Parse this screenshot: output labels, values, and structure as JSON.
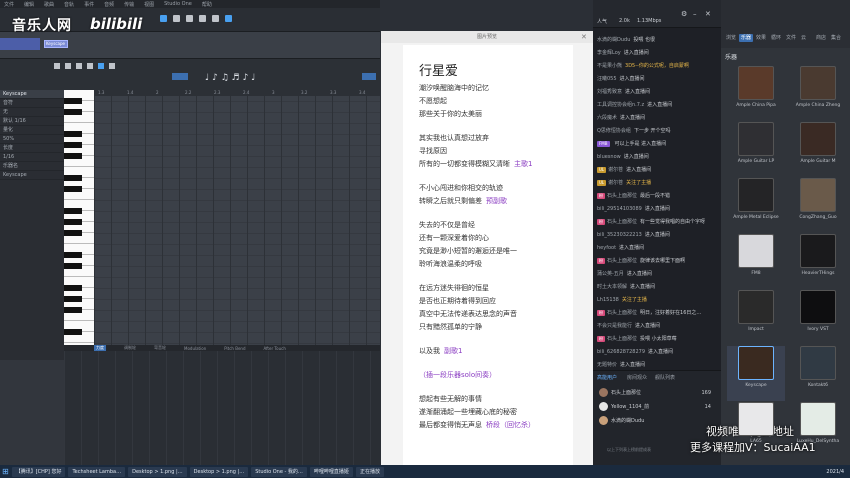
{
  "daw": {
    "menu": [
      "文件",
      "编辑",
      "歌曲",
      "音轨",
      "事件",
      "音频",
      "传输",
      "视图",
      "Studio One",
      "帮助"
    ],
    "track_name": "Keyscape",
    "editor": {
      "instrument": "Keyscape",
      "tabs": [
        "力度",
        "调制轮",
        "弯音轮",
        "Modulation",
        "Pitch Bend",
        "After Touch"
      ],
      "left_panel_rows": [
        "音符",
        "无",
        "默认 1/16",
        "量化",
        "50%",
        "长度",
        "1/16",
        "乐器名",
        "Keyscape"
      ],
      "ruler": [
        "1.3",
        "1.4",
        "2",
        "2.2",
        "2.3",
        "2.4",
        "3",
        "3.2",
        "3.3",
        "3.4"
      ]
    }
  },
  "watermark": {
    "site": "音乐人网",
    "bili": "bilibili"
  },
  "lyrics": {
    "window_title": "图片预览",
    "title": "行星爱",
    "verses": [
      {
        "lines": [
          "潮汐唤醒脑海中的记忆",
          "不愿想起",
          "那些关于你的太美丽"
        ]
      },
      {
        "lines": [
          "其实我也认真想过放弃",
          "寻找原因",
          "所有的一切都变得模糊又清晰"
        ],
        "tag": "主歌1"
      },
      {
        "lines": [
          "不小心闯进和你相交的轨迹",
          "转瞬之后就只剩偏差"
        ],
        "tag": "预副歌"
      },
      {
        "lines": [
          "失去的不仅是曾经",
          "还有一颗深爱着你的心",
          "究竟是渺小短暂的邂逅还是唯一",
          "聆听海浪温柔的呼吸"
        ]
      },
      {
        "lines": [
          "在远方迷失徘徊的恒星",
          "是否也正期待着得到回应",
          "真空中无法传递表达思念的声音",
          "只有黯然孤单的宁静"
        ]
      },
      {
        "lines": [
          "以及我"
        ],
        "tag": "副歌1"
      },
      {
        "lines": [
          "（插一段乐器solo间奏）"
        ],
        "purple": true
      },
      {
        "lines": [
          "想起有些无解的事情",
          "遂渐翻涌起一些埋藏心底的秘密",
          "最后都变得悄无声息"
        ],
        "tag": "桥段（回忆杀）"
      }
    ]
  },
  "chat": {
    "header": {
      "popularity": "人气",
      "value": "2.0k",
      "bitrate": "1.13Mbps",
      "count": "2"
    },
    "messages": [
      {
        "user": "水滴的蝴Dudu",
        "text": "投喂 也很"
      },
      {
        "user": "李金辉Loy",
        "text": "进入直播间"
      },
      {
        "user": "不是果小熊",
        "text": "3D5--你的公式呢，自启蒙啊",
        "color": "#e8b84a"
      },
      {
        "user": "汪曦055",
        "text": "进入直播间"
      },
      {
        "user": "刘福秀致意",
        "text": "进入直播间"
      },
      {
        "user": "工具调控协会组n.7.z",
        "text": "进入直播间"
      },
      {
        "user": "六段魔术",
        "text": "进入直播间"
      },
      {
        "user": "Q思修恒协会组",
        "text": "下一步 开个空吗"
      },
      {
        "badge": "FMB",
        "badge_color": "#8a58d6",
        "user": "",
        "text": "可以上手是 进入直播间"
      },
      {
        "user": "bluesnow",
        "text": "进入直播间"
      },
      {
        "badge": "UL",
        "badge_color": "#c89a2e",
        "user": "谢尔苍",
        "text": "进入直播间"
      },
      {
        "badge": "UL",
        "badge_color": "#c89a2e",
        "user": "谢尔苍",
        "text": "关注了主播",
        "color": "#e8b84a"
      },
      {
        "badge": "粉",
        "badge_color": "#d64a7a",
        "user": "石头上面那位",
        "text": "最后一段不错"
      },
      {
        "user": "bili_29514103089",
        "text": "进入直播间"
      },
      {
        "badge": "粉",
        "badge_color": "#d64a7a",
        "user": "石头上面那位",
        "text": "有一些觉得我唱的自由个字呀"
      },
      {
        "user": "bili_35230322213",
        "text": "进入直播间"
      },
      {
        "user": "heyfoot",
        "text": "进入直播间"
      },
      {
        "badge": "粉",
        "badge_color": "#d64a7a",
        "user": "石头上面那位",
        "text": "旋律该去哪里下面啊"
      },
      {
        "user": "蒲公英-五月",
        "text": "进入直播间"
      },
      {
        "user": "时土大本领解",
        "text": "进入直播间"
      },
      {
        "user": "Lh15138",
        "text": "关注了主播",
        "color": "#e8b84a"
      },
      {
        "badge": "粉",
        "badge_color": "#d64a7a",
        "user": "石头上面那位",
        "text": "明日，注好着好在16日之…"
      },
      {
        "user": "不会只是我能行",
        "text": "进入直播间"
      },
      {
        "badge": "粉",
        "badge_color": "#d64a7a",
        "user": "石头上面那位",
        "text": "投喂 小太阳草莓"
      },
      {
        "user": "bili_626828728279",
        "text": "进入直播间"
      },
      {
        "user": "无题特价",
        "text": "进入直播间"
      }
    ],
    "rank": {
      "tabs": [
        "高能用户",
        "房间观众",
        "舰队列表"
      ],
      "rows": [
        {
          "name": "石头上面那位",
          "score": "169"
        },
        {
          "name": "Yellow_1104_前",
          "score": "14"
        },
        {
          "name": "水滴的蝴Dudu",
          "score": ""
        }
      ],
      "footer": "以上下列表上榜前提成表"
    }
  },
  "browser": {
    "title_tabs": [
      "浏览",
      "乐器",
      "效果",
      "循环",
      "文件",
      "云",
      "商店",
      "集合"
    ],
    "section": "乐器",
    "instruments": [
      {
        "name": "Ample China Pipa",
        "color": "#5a3a2a"
      },
      {
        "name": "Ample China Zheng",
        "color": "#4a3a30"
      },
      {
        "name": "Ample Guitar LP",
        "color": "#2f2f33"
      },
      {
        "name": "Ample Guitar M",
        "color": "#3a2a24"
      },
      {
        "name": "Ample Metal Eclipse",
        "color": "#242426"
      },
      {
        "name": "CongZhang_Guo",
        "color": "#6a5a4a"
      },
      {
        "name": "FM8",
        "color": "#d8d8dc"
      },
      {
        "name": "HeavierTHings",
        "color": "#1a1a1c"
      },
      {
        "name": "Impact",
        "color": "#2a2a2a"
      },
      {
        "name": "Ivory VST",
        "color": "#0e0e10"
      },
      {
        "name": "Keyscape",
        "color": "#3a2a20",
        "selected": true
      },
      {
        "name": "Kontakt6",
        "color": "#303a44"
      },
      {
        "name": "LA65",
        "color": "#e8e8ea"
      },
      {
        "name": "LuxeHu_DelSyntha",
        "color": "#e4ece6"
      }
    ]
  },
  "taskbar": {
    "items": [
      "【腾讯】[CHP] 您好",
      "Techsheet Lamba…",
      "Desktop > 1.png |…",
      "Desktop > 1.png |…",
      "Studio One - 我的…",
      "哔哩哔哩直播姬",
      "正在播放"
    ],
    "clock": "2021/4"
  },
  "overlay": {
    "line1": "视频唯一更新地址",
    "line2": "更多课程加V：SucaiAA1"
  }
}
